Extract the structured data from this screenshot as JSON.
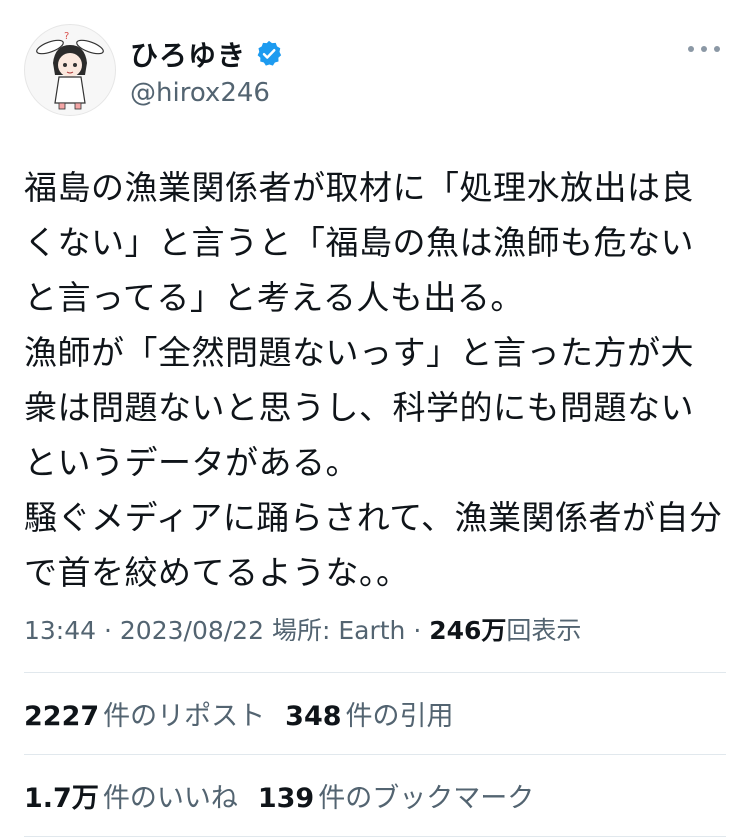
{
  "profile": {
    "display_name": "ひろゆき",
    "handle": "@hirox246"
  },
  "tweet": {
    "lines": [
      "福島の漁業関係者が取材に「処理水放出は良くない」と言うと「福島の魚は漁師も危ないと言ってる」と考える人も出る。",
      "漁師が「全然問題ないっす」と言った方が大衆は問題ないと思うし、科学的にも問題ないというデータがある。",
      "騒ぐメディアに踊らされて、漁業関係者が自分で首を絞めてるような。。"
    ]
  },
  "meta": {
    "time": "13:44",
    "date": "2023/08/22",
    "location_label": "場所: Earth",
    "views_count": "246万",
    "views_label": "回表示"
  },
  "stats": {
    "reposts_count": "2227",
    "reposts_label": "件のリポスト",
    "quotes_count": "348",
    "quotes_label": "件の引用",
    "likes_count": "1.7万",
    "likes_label": "件のいいね",
    "bookmarks_count": "139",
    "bookmarks_label": "件のブックマーク"
  },
  "colors": {
    "verified_badge": "#1d9bf0",
    "secondary_text": "#536471",
    "primary_text": "#0f1419"
  },
  "icons": {
    "verified": "verified-badge-icon",
    "more": "more-options-icon"
  }
}
